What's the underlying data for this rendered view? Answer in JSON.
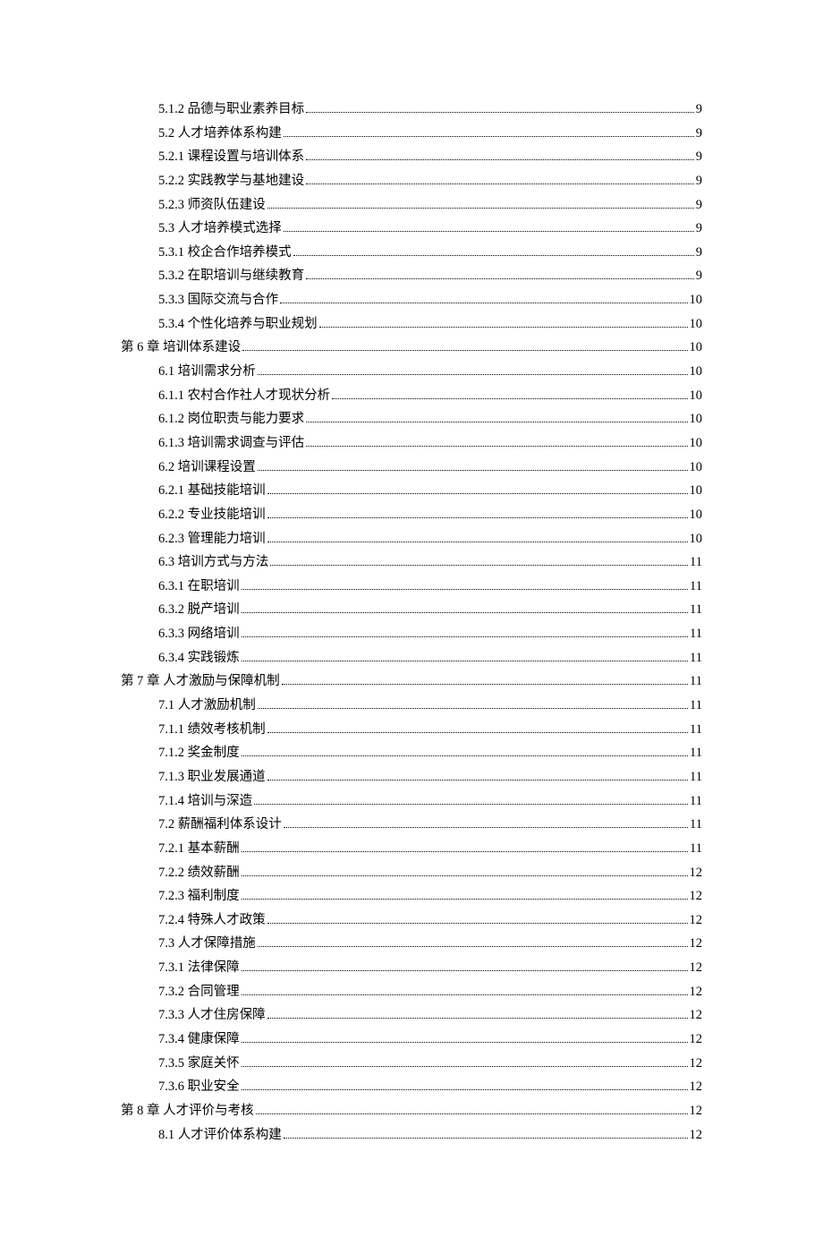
{
  "toc": [
    {
      "level": 2,
      "text": "5.1.2 品德与职业素养目标",
      "page": "9"
    },
    {
      "level": 2,
      "text": "5.2 人才培养体系构建",
      "page": "9"
    },
    {
      "level": 2,
      "text": "5.2.1 课程设置与培训体系",
      "page": "9"
    },
    {
      "level": 2,
      "text": "5.2.2 实践教学与基地建设",
      "page": "9"
    },
    {
      "level": 2,
      "text": "5.2.3 师资队伍建设",
      "page": "9"
    },
    {
      "level": 2,
      "text": "5.3 人才培养模式选择",
      "page": "9"
    },
    {
      "level": 2,
      "text": "5.3.1 校企合作培养模式",
      "page": "9"
    },
    {
      "level": 2,
      "text": "5.3.2 在职培训与继续教育",
      "page": "9"
    },
    {
      "level": 2,
      "text": "5.3.3 国际交流与合作",
      "page": "10"
    },
    {
      "level": 2,
      "text": "5.3.4 个性化培养与职业规划",
      "page": "10"
    },
    {
      "level": 1,
      "text": "第 6 章 培训体系建设",
      "page": "10"
    },
    {
      "level": 2,
      "text": "6.1 培训需求分析",
      "page": "10"
    },
    {
      "level": 2,
      "text": "6.1.1 农村合作社人才现状分析",
      "page": "10"
    },
    {
      "level": 2,
      "text": "6.1.2 岗位职责与能力要求",
      "page": "10"
    },
    {
      "level": 2,
      "text": "6.1.3 培训需求调查与评估",
      "page": "10"
    },
    {
      "level": 2,
      "text": "6.2 培训课程设置",
      "page": "10"
    },
    {
      "level": 2,
      "text": "6.2.1 基础技能培训",
      "page": "10"
    },
    {
      "level": 2,
      "text": "6.2.2 专业技能培训",
      "page": "10"
    },
    {
      "level": 2,
      "text": "6.2.3 管理能力培训",
      "page": "10"
    },
    {
      "level": 2,
      "text": "6.3 培训方式与方法",
      "page": "11"
    },
    {
      "level": 2,
      "text": "6.3.1 在职培训 ",
      "page": "11"
    },
    {
      "level": 2,
      "text": "6.3.2 脱产培训 ",
      "page": "11"
    },
    {
      "level": 2,
      "text": "6.3.3 网络培训 ",
      "page": "11"
    },
    {
      "level": 2,
      "text": "6.3.4 实践锻炼 ",
      "page": "11"
    },
    {
      "level": 1,
      "text": "第 7 章 人才激励与保障机制",
      "page": "11"
    },
    {
      "level": 2,
      "text": "7.1 人才激励机制",
      "page": "11"
    },
    {
      "level": 2,
      "text": "7.1.1 绩效考核机制",
      "page": "11"
    },
    {
      "level": 2,
      "text": "7.1.2 奖金制度 ",
      "page": "11"
    },
    {
      "level": 2,
      "text": "7.1.3 职业发展通道",
      "page": "11"
    },
    {
      "level": 2,
      "text": "7.1.4 培训与深造",
      "page": "11"
    },
    {
      "level": 2,
      "text": "7.2 薪酬福利体系设计",
      "page": "11"
    },
    {
      "level": 2,
      "text": "7.2.1 基本薪酬 ",
      "page": "11"
    },
    {
      "level": 2,
      "text": "7.2.2 绩效薪酬 ",
      "page": "12"
    },
    {
      "level": 2,
      "text": "7.2.3 福利制度 ",
      "page": "12"
    },
    {
      "level": 2,
      "text": "7.2.4 特殊人才政策",
      "page": "12"
    },
    {
      "level": 2,
      "text": "7.3 人才保障措施",
      "page": "12"
    },
    {
      "level": 2,
      "text": "7.3.1 法律保障 ",
      "page": "12"
    },
    {
      "level": 2,
      "text": "7.3.2 合同管理 ",
      "page": "12"
    },
    {
      "level": 2,
      "text": "7.3.3 人才住房保障",
      "page": "12"
    },
    {
      "level": 2,
      "text": "7.3.4 健康保障 ",
      "page": "12"
    },
    {
      "level": 2,
      "text": "7.3.5 家庭关怀 ",
      "page": "12"
    },
    {
      "level": 2,
      "text": "7.3.6 职业安全 ",
      "page": "12"
    },
    {
      "level": 1,
      "text": "第 8 章 人才评价与考核",
      "page": "12"
    },
    {
      "level": 2,
      "text": "8.1 人才评价体系构建",
      "page": "12"
    }
  ]
}
